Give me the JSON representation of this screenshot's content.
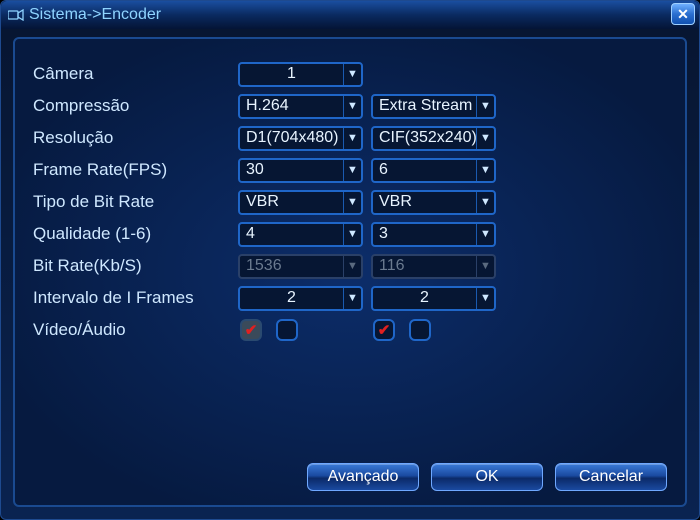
{
  "title": "Sistema->Encoder",
  "labels": {
    "camera": "Câmera",
    "compression": "Compressão",
    "resolution": "Resolução",
    "frame_rate": "Frame Rate(FPS)",
    "bitrate_type": "Tipo de Bit Rate",
    "quality": "Qualidade (1-6)",
    "bitrate": "Bit Rate(Kb/S)",
    "iframe_interval": "Intervalo de I Frames",
    "video_audio": "Vídeo/Áudio"
  },
  "main": {
    "camera": "1",
    "compression": "H.264",
    "resolution": "D1(704x480)",
    "frame_rate": "30",
    "bitrate_type": "VBR",
    "quality": "4",
    "bitrate": "1536",
    "iframe_interval": "2",
    "video_checked": true,
    "audio_checked": false
  },
  "extra": {
    "stream_label": "Extra Stream",
    "resolution": "CIF(352x240)",
    "frame_rate": "6",
    "bitrate_type": "VBR",
    "quality": "3",
    "bitrate": "116",
    "iframe_interval": "2",
    "video_checked": true,
    "audio_checked": false
  },
  "buttons": {
    "advanced": "Avançado",
    "ok": "OK",
    "cancel": "Cancelar"
  }
}
